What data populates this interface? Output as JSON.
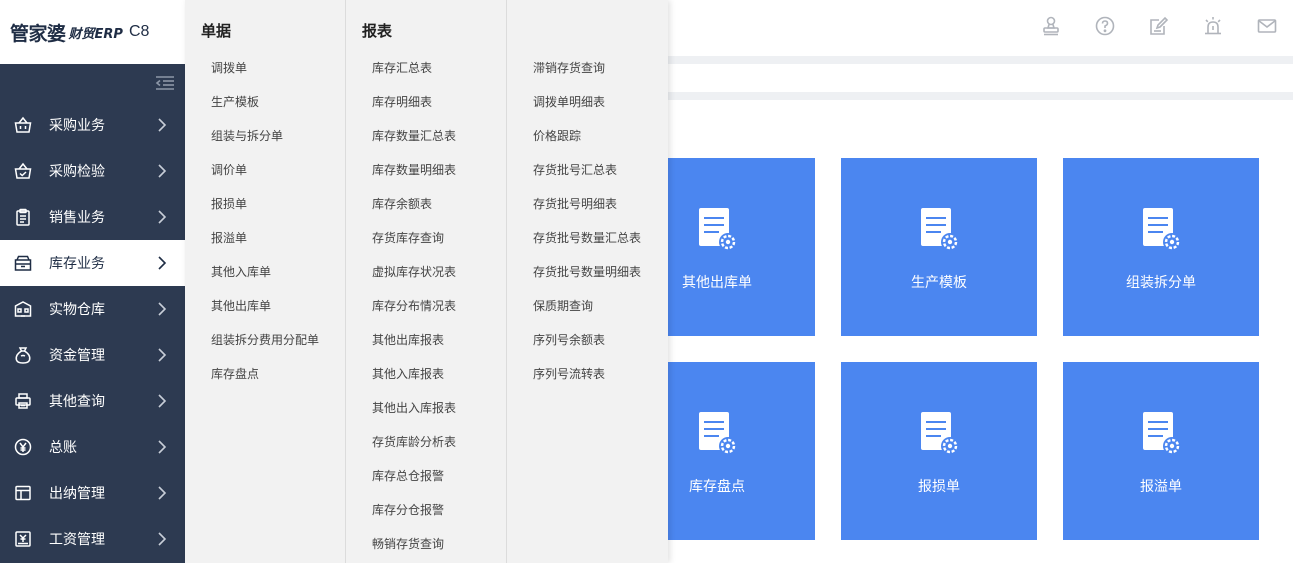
{
  "logo": {
    "brand": "管家婆",
    "product": "财贸ERP",
    "version": "C8"
  },
  "header_icons": [
    "stamp-icon",
    "help-icon",
    "edit-icon",
    "alarm-icon",
    "mail-icon"
  ],
  "sidebar": {
    "items": [
      {
        "label": "采购业务",
        "icon": "basket-icon",
        "active": false
      },
      {
        "label": "采购检验",
        "icon": "basket-check-icon",
        "active": false
      },
      {
        "label": "销售业务",
        "icon": "clipboard-icon",
        "active": false
      },
      {
        "label": "库存业务",
        "icon": "inventory-icon",
        "active": true
      },
      {
        "label": "实物仓库",
        "icon": "warehouse-icon",
        "active": false
      },
      {
        "label": "资金管理",
        "icon": "money-bag-icon",
        "active": false
      },
      {
        "label": "其他查询",
        "icon": "printer-icon",
        "active": false
      },
      {
        "label": "总账",
        "icon": "yen-icon",
        "active": false
      },
      {
        "label": "出纳管理",
        "icon": "layout-icon",
        "active": false
      },
      {
        "label": "工资管理",
        "icon": "payroll-icon",
        "active": false
      }
    ]
  },
  "dropdown": {
    "col1": {
      "title": "单据",
      "links": [
        "调拨单",
        "生产模板",
        "组装与拆分单",
        "调价单",
        "报损单",
        "报溢单",
        "其他入库单",
        "其他出库单",
        "组装拆分费用分配单",
        "库存盘点"
      ]
    },
    "col2": {
      "title": "报表",
      "links": [
        "库存汇总表",
        "库存明细表",
        "库存数量汇总表",
        "库存数量明细表",
        "库存余额表",
        "存货库存查询",
        "虚拟库存状况表",
        "库存分布情况表",
        "其他出库报表",
        "其他入库报表",
        "其他出入库报表",
        "存货库龄分析表",
        "库存总仓报警",
        "库存分仓报警",
        "畅销存货查询"
      ]
    },
    "col3": {
      "title": "",
      "links": [
        "滞销存货查询",
        "调拨单明细表",
        "价格跟踪",
        "存货批号汇总表",
        "存货批号明细表",
        "存货批号数量汇总表",
        "存货批号数量明细表",
        "保质期查询",
        "序列号余额表",
        "序列号流转表"
      ]
    }
  },
  "tiles": [
    {
      "label": "其他出库单"
    },
    {
      "label": "生产模板"
    },
    {
      "label": "组装拆分单"
    },
    {
      "label": "库存盘点"
    },
    {
      "label": "报损单"
    },
    {
      "label": "报溢单"
    }
  ],
  "colors": {
    "sidebar_bg": "#2d3a51",
    "tile_bg": "#4b86f0",
    "dropdown_bg": "#f2f2f2"
  }
}
